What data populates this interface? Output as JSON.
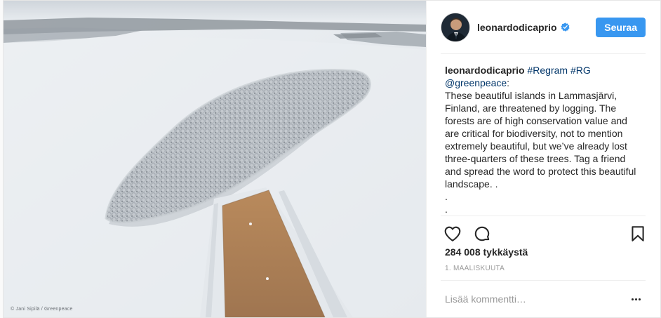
{
  "post": {
    "image_alt": "Snowy forested island in a frozen lake with a plowed road",
    "photo_credit": "© Jani Sipilä / Greenpeace"
  },
  "header": {
    "username": "leonardodicaprio",
    "follow_label": "Seuraa"
  },
  "caption": {
    "username": "leonardodicaprio",
    "tags": "#Regram #RG",
    "mention": "@greenpeace",
    "colon": ":",
    "body": "These beautiful islands in Lammasjärvi, Finland, are threatened by logging. The forests are of high conservation value and are critical for biodiversity, not to mention extremely beautiful, but we’ve already lost three-quarters of these trees. Tag a friend and spread the word to protect this beautiful landscape. .\n.\n."
  },
  "stats": {
    "likes": "284 008 tykkäystä",
    "date": "1. MAALISKUUTA"
  },
  "comment": {
    "placeholder": "Lisää kommentti…"
  },
  "icons": {
    "like": "heart-icon",
    "comment": "speech-bubble-icon",
    "save": "bookmark-icon",
    "verified": "verified-badge-icon",
    "more": "more-options-icon"
  },
  "colors": {
    "follow_button": "#3897f0",
    "verified": "#3897f0",
    "border": "#efefef"
  }
}
